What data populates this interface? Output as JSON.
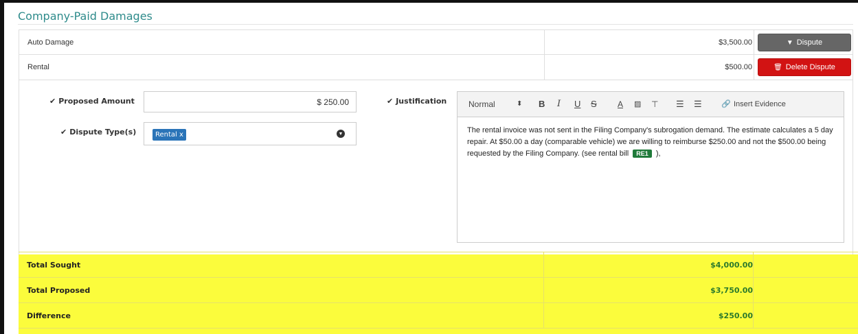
{
  "section": {
    "title": "Company-Paid Damages"
  },
  "damages": [
    {
      "label": "Auto Damage",
      "amount": "$3,500.00",
      "button": "Dispute",
      "button_icon": "caret-down-icon"
    },
    {
      "label": "Rental",
      "amount": "$500.00",
      "button": "Delete Dispute",
      "button_icon": "trash-icon"
    }
  ],
  "dispute_form": {
    "proposed_amount_label": "Proposed Amount",
    "proposed_amount_value": "$ 250.00",
    "dispute_types_label": "Dispute Type(s)",
    "dispute_type_tag": "Rental x",
    "justification_label": "Justification"
  },
  "editor": {
    "toolbar": {
      "format": "Normal",
      "bold": "B",
      "italic": "I",
      "underline": "U",
      "strike": "S",
      "color": "A",
      "insert_evidence": "Insert Evidence"
    },
    "text_before": "The rental invoice was not  sent in the Filing Company's subrogation demand.  The estimate calculates a 5 day repair.  At $50.00 a day (comparable vehicle) we are willing to reimburse $250.00 and not the $500.00 being requested by the Filing Company.  (see rental bill ",
    "evidence_tag": "RE1",
    "text_after": " ),"
  },
  "totals": [
    {
      "label": "Total Sought",
      "value": "$4,000.00"
    },
    {
      "label": "Total Proposed",
      "value": "$3,750.00"
    },
    {
      "label": "Difference",
      "value": "$250.00"
    }
  ],
  "colors": {
    "title": "#2e8b8b",
    "dispute_button": "#666666",
    "delete_button": "#d21313",
    "totals_highlight": "#fbfc3c",
    "totals_value": "#2c7a2c",
    "tag": "#2a74b8",
    "evidence_tag": "#1f7a3a"
  }
}
